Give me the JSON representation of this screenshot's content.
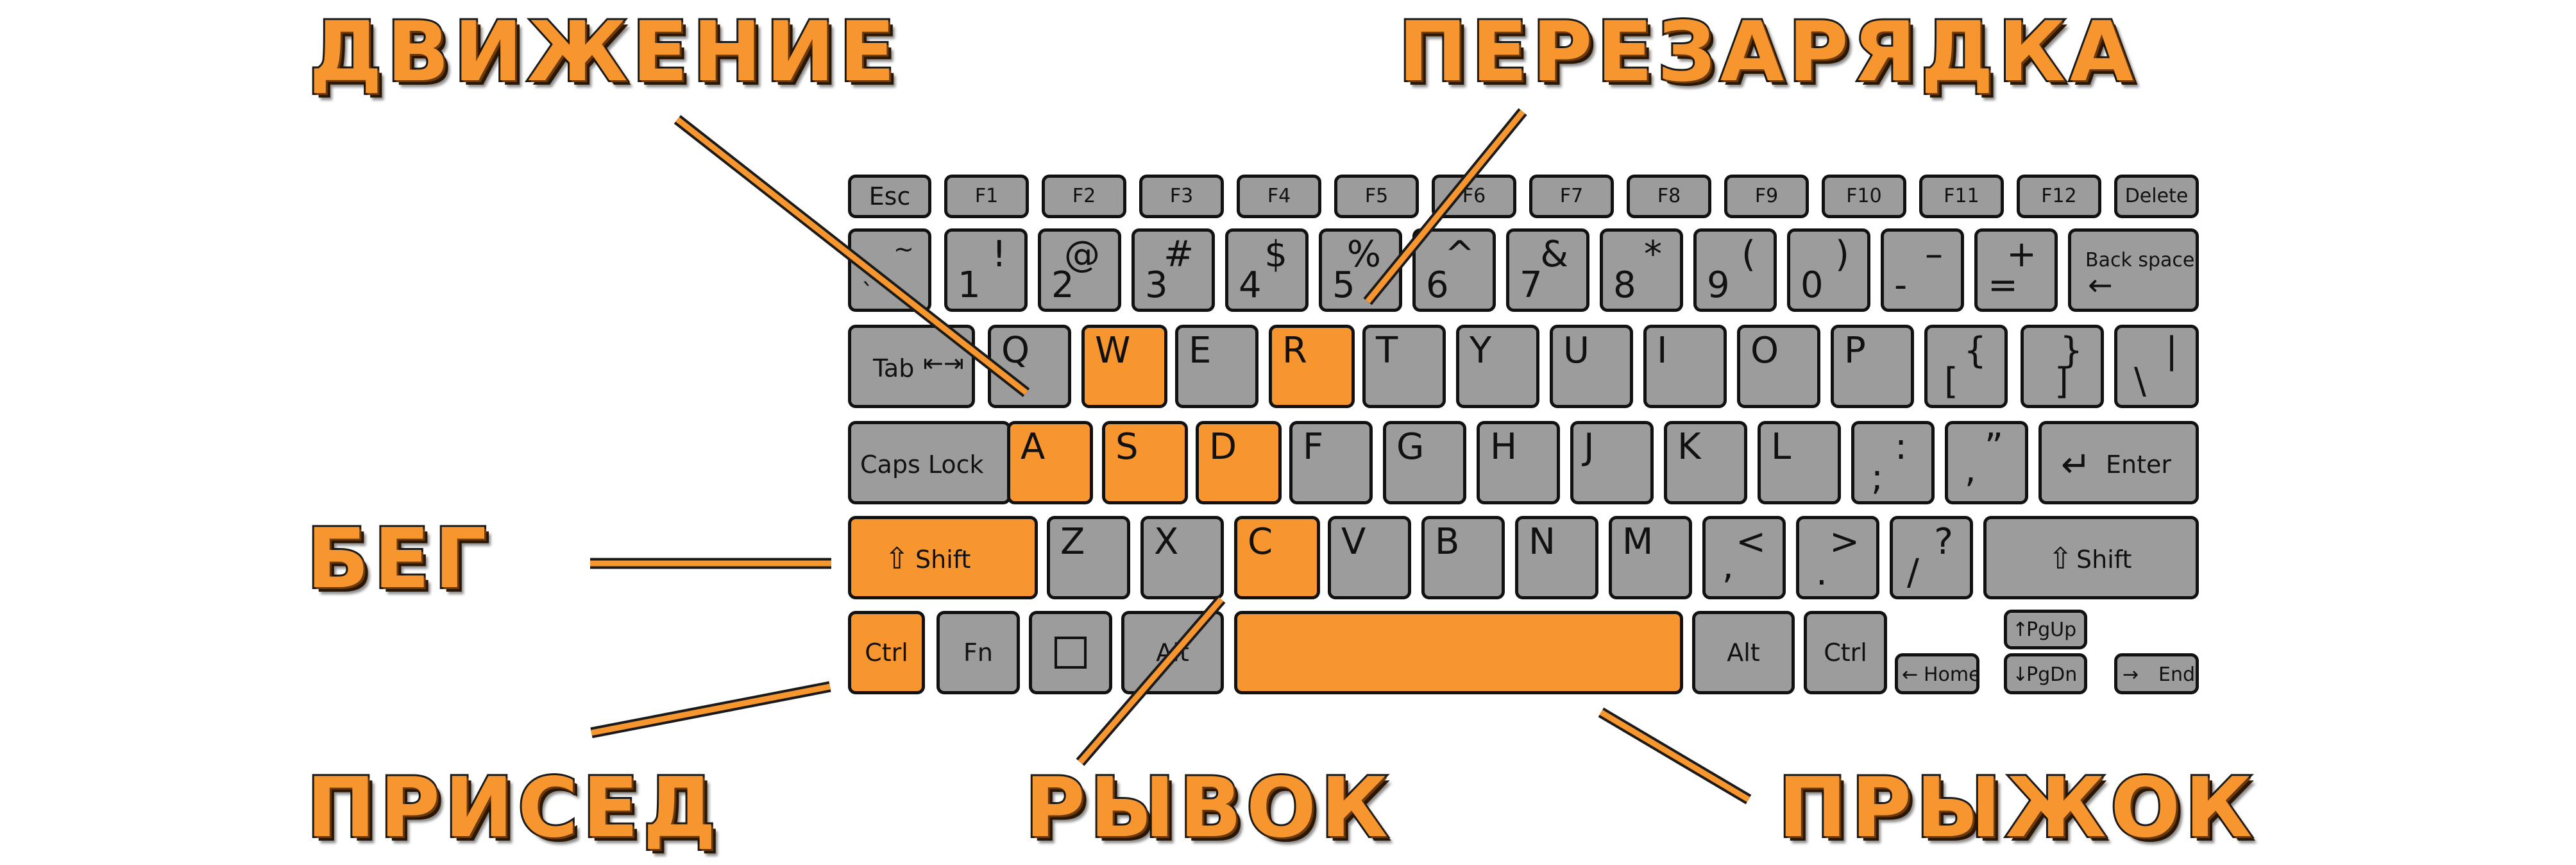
{
  "labels": {
    "movement": "ДВИЖЕНИЕ",
    "reload": "ПЕРЕЗАРЯДКА",
    "run": "БЕГ",
    "crouch": "ПРИСЕД",
    "dash": "РЫВОК",
    "jump": "ПРЫЖОК"
  },
  "keyboard": {
    "function_row": [
      "Esc",
      "F1",
      "F2",
      "F3",
      "F4",
      "F5",
      "F6",
      "F7",
      "F8",
      "F9",
      "F10",
      "F11",
      "F12",
      "Delete"
    ],
    "number_row": [
      {
        "top": "~",
        "bottom": "`"
      },
      {
        "top": "!",
        "bottom": "1"
      },
      {
        "top": "@",
        "bottom": "2"
      },
      {
        "top": "#",
        "bottom": "3"
      },
      {
        "top": "$",
        "bottom": "4"
      },
      {
        "top": "%",
        "bottom": "5"
      },
      {
        "top": "^",
        "bottom": "6"
      },
      {
        "top": "&",
        "bottom": "7"
      },
      {
        "top": "*",
        "bottom": "8"
      },
      {
        "top": "(",
        "bottom": "9"
      },
      {
        "top": ")",
        "bottom": "0"
      },
      {
        "top": "–",
        "bottom": "-"
      },
      {
        "top": "+",
        "bottom": "="
      }
    ],
    "backspace": "Back space",
    "tab": "Tab",
    "tab_arrows": "⇤⇥",
    "qwerty_row": [
      "Q",
      "W",
      "E",
      "R",
      "T",
      "Y",
      "U",
      "I",
      "O",
      "P"
    ],
    "bracket_open": {
      "top": "{",
      "bottom": "["
    },
    "bracket_close": {
      "top": "}",
      "bottom": "]"
    },
    "backslash": {
      "top": "|",
      "bottom": "\\"
    },
    "caps_lock": "Caps Lock",
    "home_row": [
      "A",
      "S",
      "D",
      "F",
      "G",
      "H",
      "J",
      "K",
      "L"
    ],
    "semicolon": {
      "top": ":",
      "bottom": ";"
    },
    "quote": {
      "top": "”",
      "bottom": ","
    },
    "enter": "Enter",
    "enter_arrow": "↵",
    "left_shift": "Shift",
    "right_shift": "Shift",
    "shift_arrow": "⇧",
    "bottom_letters": [
      "Z",
      "X",
      "C",
      "V",
      "B",
      "N",
      "M"
    ],
    "comma": {
      "top": "<",
      "bottom": ","
    },
    "period": {
      "top": ">",
      "bottom": "."
    },
    "slash": {
      "top": "?",
      "bottom": "/"
    },
    "ctrl_left": "Ctrl",
    "fn": "Fn",
    "alt_left": "Alt",
    "alt_right": "Alt",
    "ctrl_right": "Ctrl",
    "home": "Home",
    "pgup": "PgUp",
    "pgdn": "PgDn",
    "end": "End",
    "arrow_left": "←",
    "arrow_up": "↑",
    "arrow_down": "↓",
    "arrow_right": "→"
  },
  "highlighted_keys": [
    "W",
    "R",
    "A",
    "S",
    "D",
    "C",
    "Shift (left)",
    "Ctrl (left)",
    "Space"
  ],
  "colors": {
    "highlight": "#f7962e",
    "key": "#9c9c9c",
    "outline": "#111111",
    "background": "#ffffff"
  }
}
